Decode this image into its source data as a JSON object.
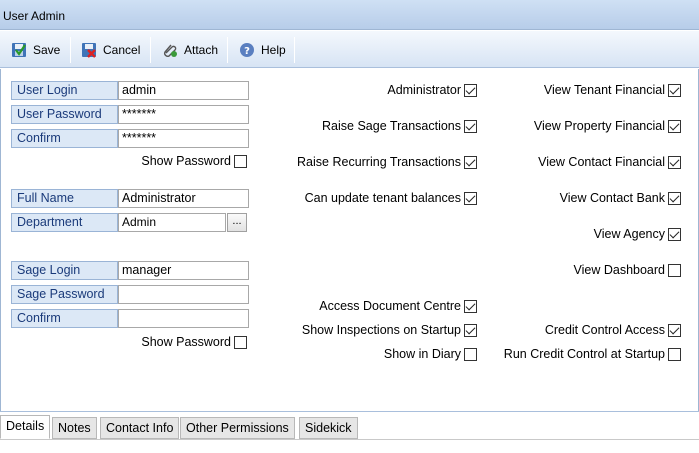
{
  "window": {
    "title": "User Admin"
  },
  "toolbar": {
    "save": "Save",
    "cancel": "Cancel",
    "attach": "Attach",
    "help": "Help"
  },
  "form": {
    "user_login_label": "User Login",
    "user_login_value": "admin",
    "user_password_label": "User Password",
    "user_password_value": "*******",
    "confirm_label": "Confirm",
    "confirm_value": "*******",
    "show_password_1": "Show Password",
    "full_name_label": "Full Name",
    "full_name_value": "Administrator",
    "department_label": "Department",
    "department_value": "Admin",
    "department_button": "...",
    "sage_login_label": "Sage Login",
    "sage_login_value": "manager",
    "sage_password_label": "Sage Password",
    "sage_password_value": "",
    "sage_confirm_label": "Confirm",
    "sage_confirm_value": "",
    "show_password_2": "Show Password"
  },
  "permissions_middle": [
    {
      "label": "Administrator",
      "checked": true
    },
    {
      "label": "Raise Sage Transactions",
      "checked": true
    },
    {
      "label": "Raise Recurring Transactions",
      "checked": true
    },
    {
      "label": "Can update tenant balances",
      "checked": true
    },
    {
      "label": "Access Document Centre",
      "checked": true
    },
    {
      "label": "Show Inspections on Startup",
      "checked": true
    },
    {
      "label": "Show in Diary",
      "checked": false
    }
  ],
  "permissions_right": [
    {
      "label": "View Tenant Financial",
      "checked": true
    },
    {
      "label": "View Property Financial",
      "checked": true
    },
    {
      "label": "View Contact Financial",
      "checked": true
    },
    {
      "label": "View Contact Bank",
      "checked": true
    },
    {
      "label": "View Agency",
      "checked": true
    },
    {
      "label": "View Dashboard",
      "checked": false
    },
    {
      "label": "Credit Control Access",
      "checked": true
    },
    {
      "label": "Run Credit Control at Startup",
      "checked": false
    }
  ],
  "tabs": [
    "Details",
    "Notes",
    "Contact Info",
    "Other Permissions",
    "Sidekick"
  ]
}
